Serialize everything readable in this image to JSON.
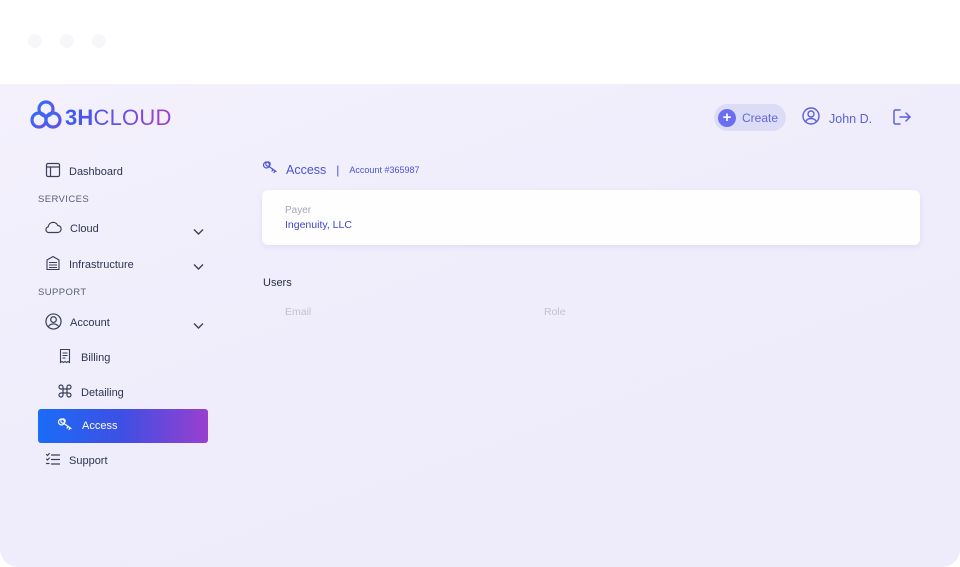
{
  "brand": {
    "name_bold": "3H",
    "name_light": "CLOUD"
  },
  "header": {
    "create_label": "Create",
    "user_name": "John D."
  },
  "sidebar": {
    "dashboard": "Dashboard",
    "services_label": "SERVICES",
    "cloud": "Cloud",
    "infrastructure": "Infrastructure",
    "support_label": "SUPPORT",
    "account": "Account",
    "billing": "Billing",
    "detailing": "Detailing",
    "access": "Access",
    "support": "Support"
  },
  "page": {
    "title": "Access",
    "separator": "|",
    "account": "Account #365987"
  },
  "payer": {
    "label": "Payer",
    "value": "Ingenuity, LLC"
  },
  "users": {
    "title": "Users",
    "columns": [
      "Email",
      "Role"
    ]
  },
  "colors": {
    "accent": "#4b52d8",
    "active_gradient_start": "#1a6cf6",
    "active_gradient_end": "#9a3fce",
    "background": "#f1effc"
  },
  "icons": {
    "logo": "cloud-knot-icon",
    "create": "plus-icon",
    "user": "user-circle-icon",
    "logout": "logout-icon",
    "dashboard": "layout-icon",
    "cloud": "cloud-icon",
    "infrastructure": "server-icon",
    "account": "user-circle-icon",
    "billing": "receipt-icon",
    "detailing": "command-icon",
    "access": "keys-icon",
    "support": "list-icon"
  }
}
